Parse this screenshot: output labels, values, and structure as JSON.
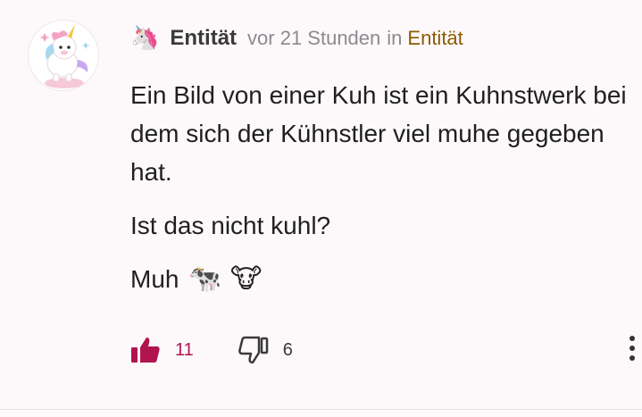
{
  "comment": {
    "avatar_icon": "unicorn-avatar",
    "author_icon": "unicorn-icon",
    "author_glyph": "🦄",
    "author": "Entität",
    "timestamp": "vor 21 Stunden",
    "in_label": "in",
    "community": "Entität",
    "paragraphs": [
      "Ein Bild von einer Kuh ist ein Kuhnstwerk bei dem sich der Kühnstler viel muhe gegeben hat.",
      "Ist das nicht kuhl?"
    ],
    "last_line": {
      "text": "Muh",
      "emoji": [
        "🐄",
        "🐮"
      ]
    },
    "upvotes": "11",
    "downvotes": "6",
    "colors": {
      "upvote": "#b0154f",
      "community": "#8a5a00",
      "meta": "#8a8a8f"
    }
  }
}
